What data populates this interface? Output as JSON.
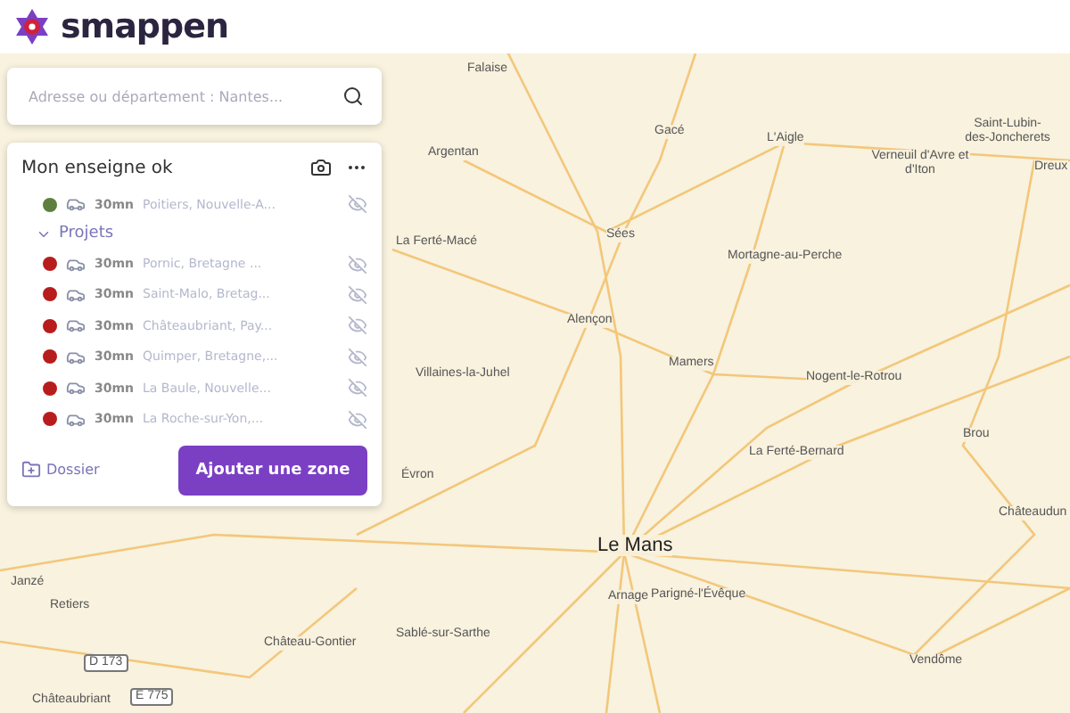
{
  "brand": {
    "name": "smappen"
  },
  "search": {
    "placeholder": "Adresse ou département : Nantes..."
  },
  "panel": {
    "title": "Mon enseigne ok",
    "groups": [
      {
        "zones": [
          {
            "time": "30mn",
            "name": "Poitiers, Nouvelle-A...",
            "color": "#5f7f3f",
            "visible": false
          }
        ]
      },
      {
        "label": "Projets",
        "expanded": true,
        "zones": [
          {
            "time": "30mn",
            "name": "Pornic, Bretagne ...",
            "color": "#b81d1d",
            "visible": false
          },
          {
            "time": "30mn",
            "name": "Saint-Malo, Bretag...",
            "color": "#b81d1d",
            "visible": false
          },
          {
            "time": "30mn",
            "name": "Châteaubriant, Pay...",
            "color": "#b81d1d",
            "visible": false
          },
          {
            "time": "30mn",
            "name": "Quimper, Bretagne,...",
            "color": "#b81d1d",
            "visible": false
          },
          {
            "time": "30mn",
            "name": "La Baule, Nouvelle...",
            "color": "#b81d1d",
            "visible": false
          },
          {
            "time": "30mn",
            "name": "La Roche-sur-Yon,...",
            "color": "#b81d1d",
            "visible": false
          }
        ]
      }
    ],
    "folder_button": "Dossier",
    "add_button": "Ajouter une zone"
  },
  "map": {
    "places": [
      {
        "name": "Falaise",
        "kind": "town"
      },
      {
        "name": "Gacé",
        "kind": "town"
      },
      {
        "name": "L'Aigle",
        "kind": "town"
      },
      {
        "name": "Argentan",
        "kind": "town"
      },
      {
        "name": "Verneuil d'Avre et d'Iton",
        "kind": "town"
      },
      {
        "name": "Saint-Lubin-des-Joncherets",
        "kind": "town"
      },
      {
        "name": "Dreux",
        "kind": "town"
      },
      {
        "name": "La Ferté-Macé",
        "kind": "town"
      },
      {
        "name": "Sées",
        "kind": "town"
      },
      {
        "name": "Mortagne-au-Perche",
        "kind": "town"
      },
      {
        "name": "Alençon",
        "kind": "town"
      },
      {
        "name": "Mamers",
        "kind": "town"
      },
      {
        "name": "Villaines-la-Juhel",
        "kind": "town"
      },
      {
        "name": "Nogent-le-Rotrou",
        "kind": "town"
      },
      {
        "name": "La Ferté-Bernard",
        "kind": "town"
      },
      {
        "name": "Brou",
        "kind": "town"
      },
      {
        "name": "Évron",
        "kind": "town"
      },
      {
        "name": "Châteaudun",
        "kind": "town"
      },
      {
        "name": "Le Mans",
        "kind": "city"
      },
      {
        "name": "Arnage",
        "kind": "town"
      },
      {
        "name": "Parigné-l'Évêque",
        "kind": "town"
      },
      {
        "name": "Sablé-sur-Sarthe",
        "kind": "town"
      },
      {
        "name": "Vendôme",
        "kind": "town"
      },
      {
        "name": "Janzé",
        "kind": "town"
      },
      {
        "name": "Retiers",
        "kind": "town"
      },
      {
        "name": "Château-Gontier",
        "kind": "town"
      },
      {
        "name": "Châteaubriant",
        "kind": "town"
      },
      {
        "name": "D 173",
        "kind": "road"
      },
      {
        "name": "E 775",
        "kind": "road"
      }
    ]
  }
}
